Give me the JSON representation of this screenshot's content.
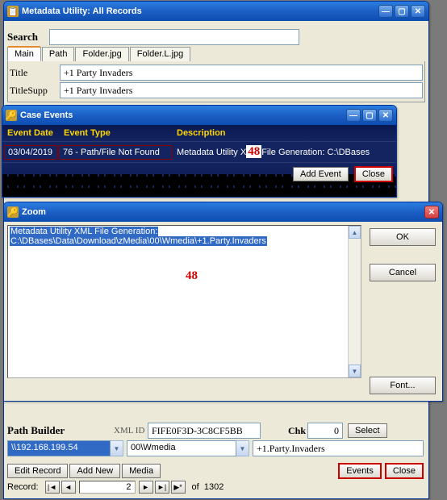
{
  "main_window": {
    "title": "Metadata Utility: All Records",
    "icon_char": "📋",
    "search_label": "Search",
    "search_value": "",
    "tabs": [
      "Main",
      "Path",
      "Folder.jpg",
      "Folder.L.jpg"
    ],
    "active_tab": 0,
    "fields": {
      "title_label": "Title",
      "title_value": "+1 Party Invaders",
      "titlesupp_label": "TitleSupp",
      "titlesupp_value": "+1 Party Invaders"
    },
    "pathbuilder": {
      "label": "Path Builder",
      "xmlid_label": "XML ID",
      "xmlid_value": "FIFE0F3D-3C8CF5BB",
      "chk_label": "Chk",
      "chk_value": "0",
      "select_btn": "Select",
      "host_value": "\\\\192.168.199.54",
      "folder_value": "00\\Wmedia",
      "file_value": "+1.Party.Invaders"
    },
    "buttons": {
      "edit": "Edit Record",
      "addnew": "Add New",
      "media": "Media",
      "events": "Events",
      "close": "Close"
    },
    "recordnav": {
      "label": "Record:",
      "current": "2",
      "of_label": "of",
      "total": "1302"
    }
  },
  "events_window": {
    "title": "Case Events",
    "headers": {
      "date": "Event Date",
      "type": "Event Type",
      "desc": "Description"
    },
    "row": {
      "date": "03/04/2019",
      "type": "76 - Path/File Not Found",
      "desc_prefix": "Metadata Utility X",
      "desc_suffix": "File Generation: C:\\DBases"
    },
    "buttons": {
      "add": "Add Event",
      "close": "Close"
    }
  },
  "zoom_window": {
    "title": "Zoom",
    "text_line1": "Metadata Utility XML File Generation:",
    "text_line2": "C:\\DBases\\Data\\Download\\zMedia\\00\\Wmedia\\+1.Party.Invaders",
    "buttons": {
      "ok": "OK",
      "cancel": "Cancel",
      "font": "Font..."
    }
  },
  "annotation": "48"
}
